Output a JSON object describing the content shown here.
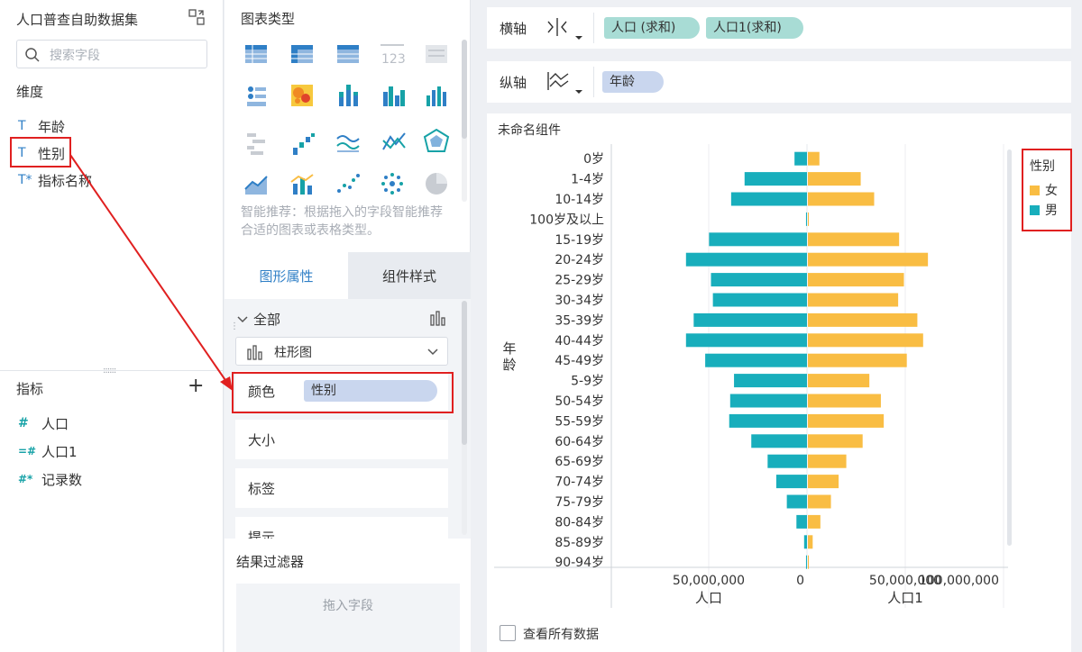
{
  "left_panel": {
    "dataset_title": "人口普查自助数据集",
    "search_placeholder": "搜索字段",
    "dimension_header": "维度",
    "dimensions": [
      {
        "name": "年龄",
        "type_icon": "T"
      },
      {
        "name": "性别",
        "type_icon": "T"
      },
      {
        "name": "指标名称",
        "type_icon": "T*"
      }
    ],
    "measure_header": "指标",
    "add_symbol": "+",
    "measures": [
      {
        "name": "人口",
        "type_icon": "#"
      },
      {
        "name": "人口1",
        "type_icon": "=#"
      },
      {
        "name": "记录数",
        "type_icon": "#*"
      }
    ]
  },
  "middle_panel": {
    "chart_type_title": "图表类型",
    "smart_hint": "智能推荐：根据拖入的字段智能推荐合适的图表或表格类型。",
    "tabs": [
      "图形属性",
      "组件样式"
    ],
    "all_label": "全部",
    "chart_select": "柱形图",
    "rows": [
      "颜色",
      "大小",
      "标签",
      "提示"
    ],
    "color_pill": "性别",
    "filter_title": "结果过滤器",
    "filter_drop": "拖入字段"
  },
  "axes": {
    "x_label": "横轴",
    "x_fields": [
      "人口 (求和)",
      "人口1(求和)"
    ],
    "y_label": "纵轴",
    "y_fields": [
      "年龄"
    ]
  },
  "component_title": "未命名组件",
  "legend": {
    "title": "性别",
    "items": [
      {
        "label": "女",
        "color": "#f9bd43"
      },
      {
        "label": "男",
        "color": "#18aebc"
      }
    ]
  },
  "view_all_label": "查看所有数据",
  "colors": {
    "accent_blue": "#2f7fc6",
    "highlight_red": "#e02020",
    "female": "#f9bd43",
    "male": "#18aebc"
  },
  "chart_data": {
    "type": "bar",
    "orientation": "horizontal-mirrored",
    "categories": [
      "0岁",
      "1-4岁",
      "10-14岁",
      "100岁及以上",
      "15-19岁",
      "20-24岁",
      "25-29岁",
      "30-34岁",
      "35-39岁",
      "40-44岁",
      "45-49岁",
      "5-9岁",
      "50-54岁",
      "55-59岁",
      "60-64岁",
      "65-69岁",
      "70-74岁",
      "75-79岁",
      "80-84岁",
      "85-89岁",
      "90-94岁"
    ],
    "series": [
      {
        "name": "男",
        "axis": "人口",
        "values": [
          6500000,
          32500000,
          39500000,
          500000,
          51000000,
          63000000,
          50000000,
          49000000,
          59000000,
          63000000,
          53000000,
          38000000,
          40000000,
          40500000,
          29000000,
          20500000,
          16000000,
          10500000,
          5500000,
          1500000,
          500000
        ]
      },
      {
        "name": "女",
        "axis": "人口1",
        "values": [
          6000000,
          27500000,
          34500000,
          500000,
          47500000,
          62500000,
          50000000,
          47000000,
          57000000,
          60000000,
          51500000,
          32000000,
          38000000,
          39500000,
          28500000,
          20000000,
          16000000,
          12000000,
          6500000,
          2500000,
          500000
        ]
      }
    ],
    "left_axis": {
      "title": "人口",
      "ticks": [
        "50,000,000",
        "0"
      ],
      "max": 100000000
    },
    "right_axis": {
      "title": "人口1",
      "ticks": [
        "50,000,000",
        "100,000,000"
      ],
      "max": 100000000
    },
    "ylabel": "年龄"
  }
}
